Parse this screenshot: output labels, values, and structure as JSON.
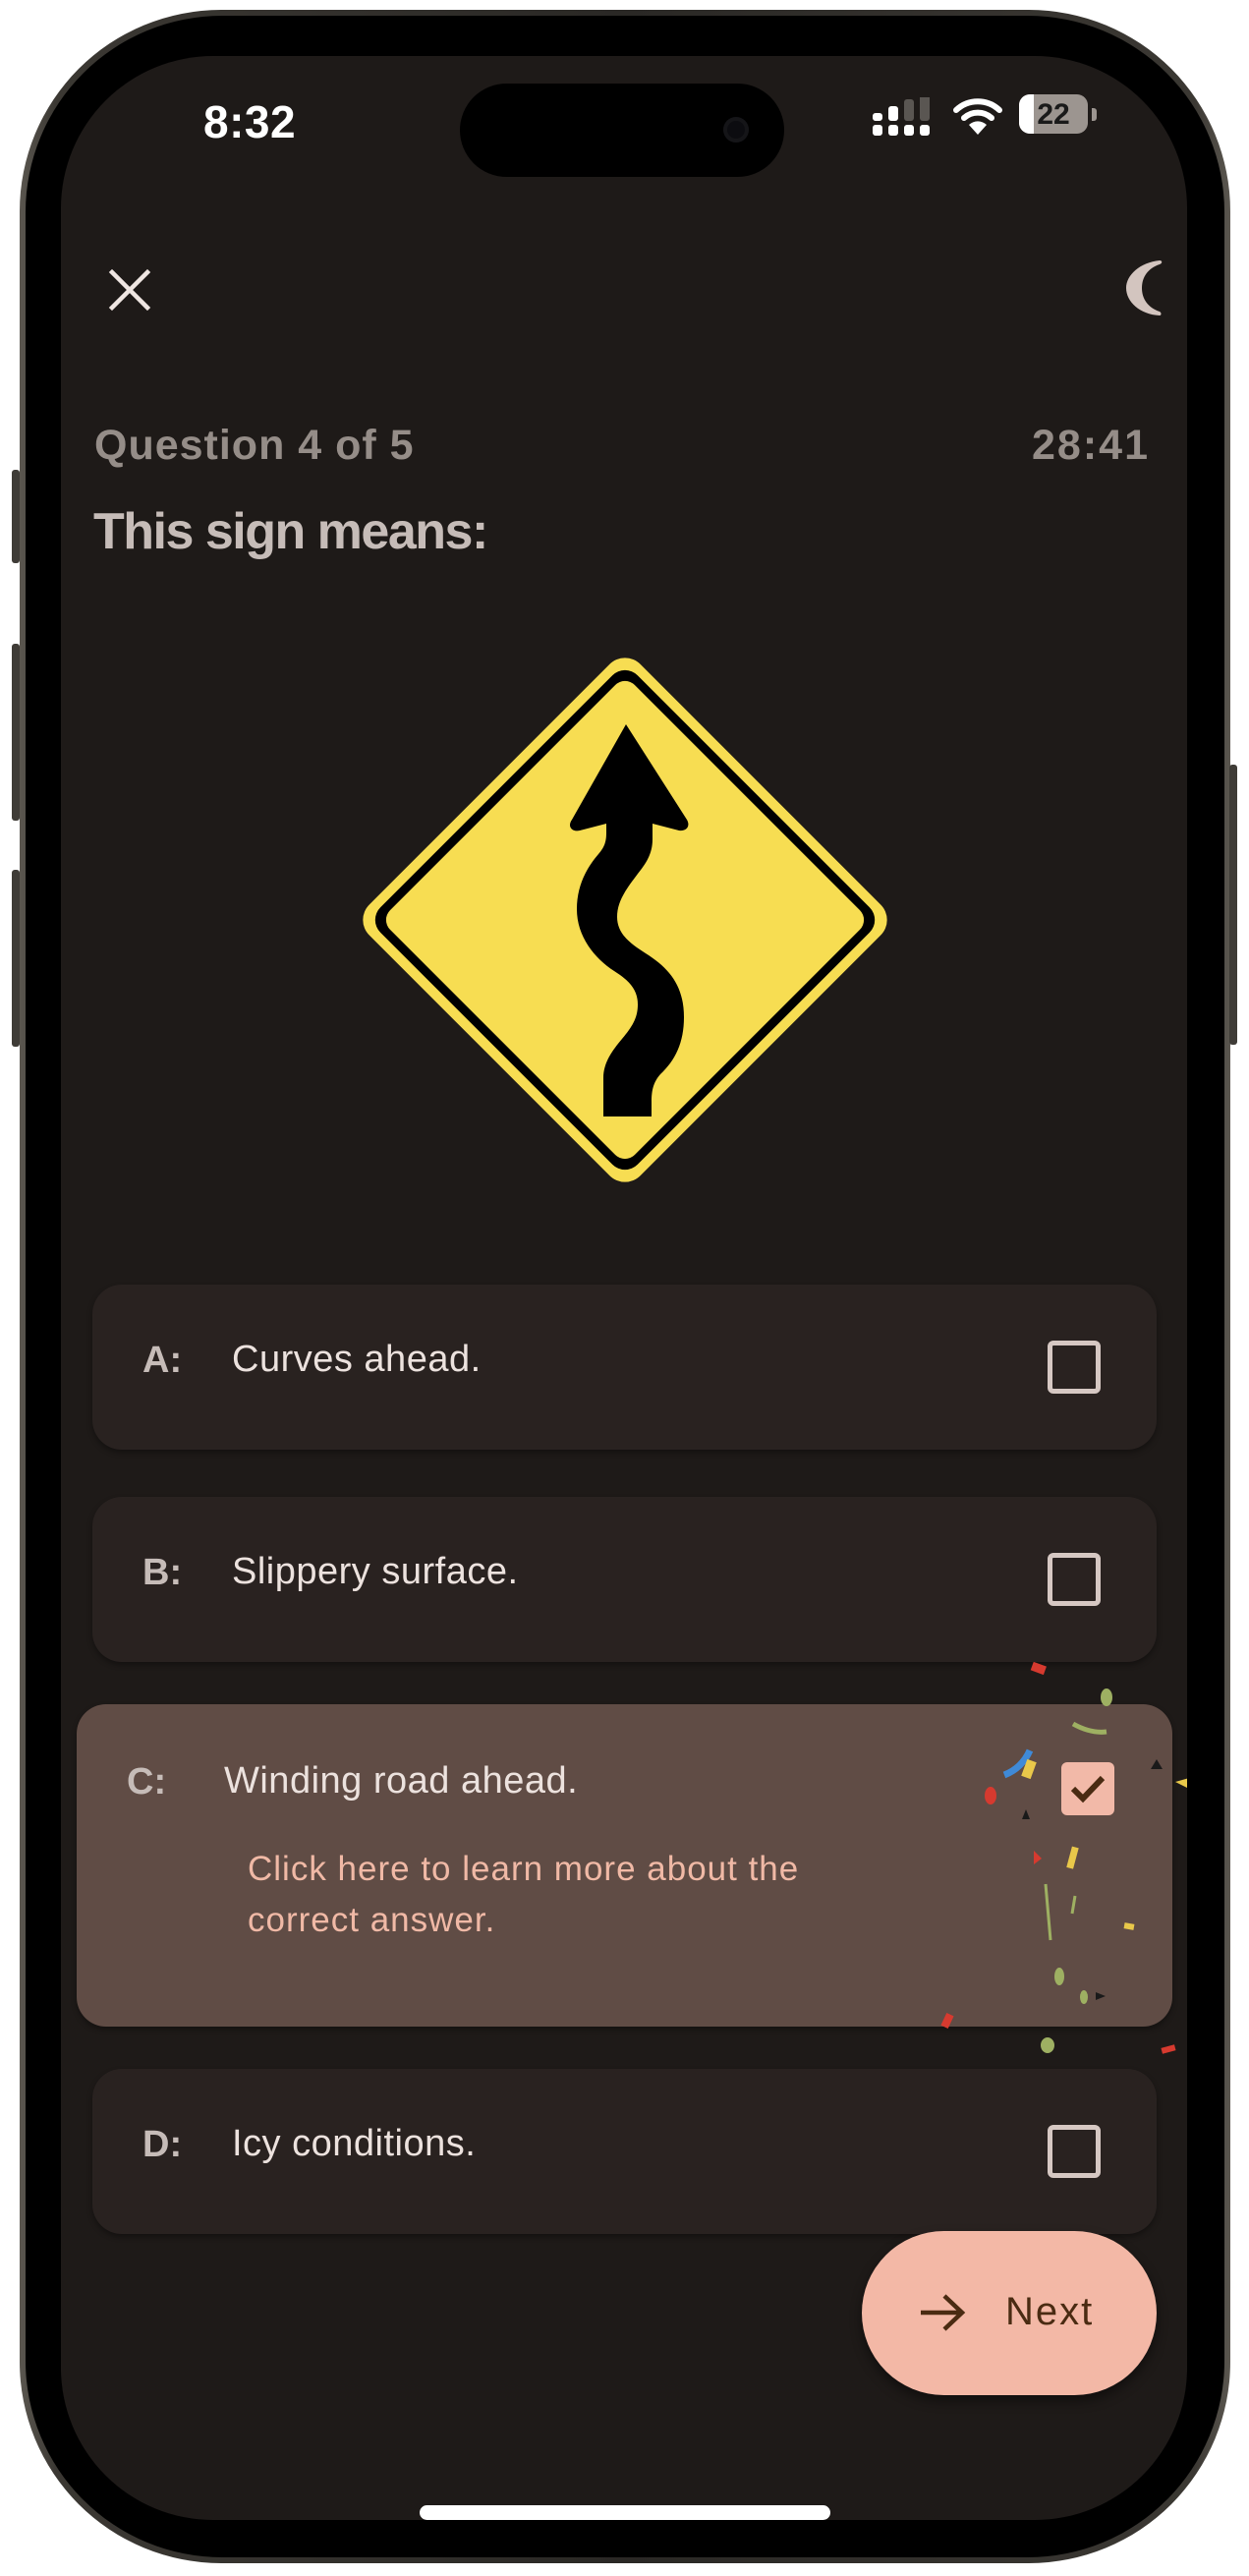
{
  "status_bar": {
    "time": "8:32",
    "signal_bars_active": 2,
    "signal_bars_total": 4,
    "wifi_icon": "wifi-icon",
    "battery_percent": 22
  },
  "header": {
    "close_icon": "close-icon",
    "theme_toggle_icon": "moon-icon"
  },
  "quiz": {
    "counter": "Question 4 of 5",
    "current": 4,
    "total": 5,
    "timer": "28:41",
    "prompt": "This sign means:",
    "image": {
      "semantic": "winding-road-warning-sign",
      "colors": {
        "fill": "#f7dd52",
        "symbol": "#000000"
      }
    },
    "options": [
      {
        "letter": "A:",
        "text": "Curves ahead.",
        "checked": false
      },
      {
        "letter": "B:",
        "text": "Slippery surface.",
        "checked": false
      },
      {
        "letter": "C:",
        "text": "Winding road ahead.",
        "checked": true,
        "correct": true,
        "learn_more": "Click here to learn more about the correct answer."
      },
      {
        "letter": "D:",
        "text": "Icy conditions.",
        "checked": false
      }
    ]
  },
  "next_button": {
    "label": "Next",
    "icon": "arrow-right-icon"
  },
  "colors": {
    "background": "#1e1a18",
    "card": "#292220",
    "card_selected": "#604c45",
    "accent": "#f3b8a6",
    "accent_text": "#4a2b12",
    "muted_text": "#958d88"
  }
}
